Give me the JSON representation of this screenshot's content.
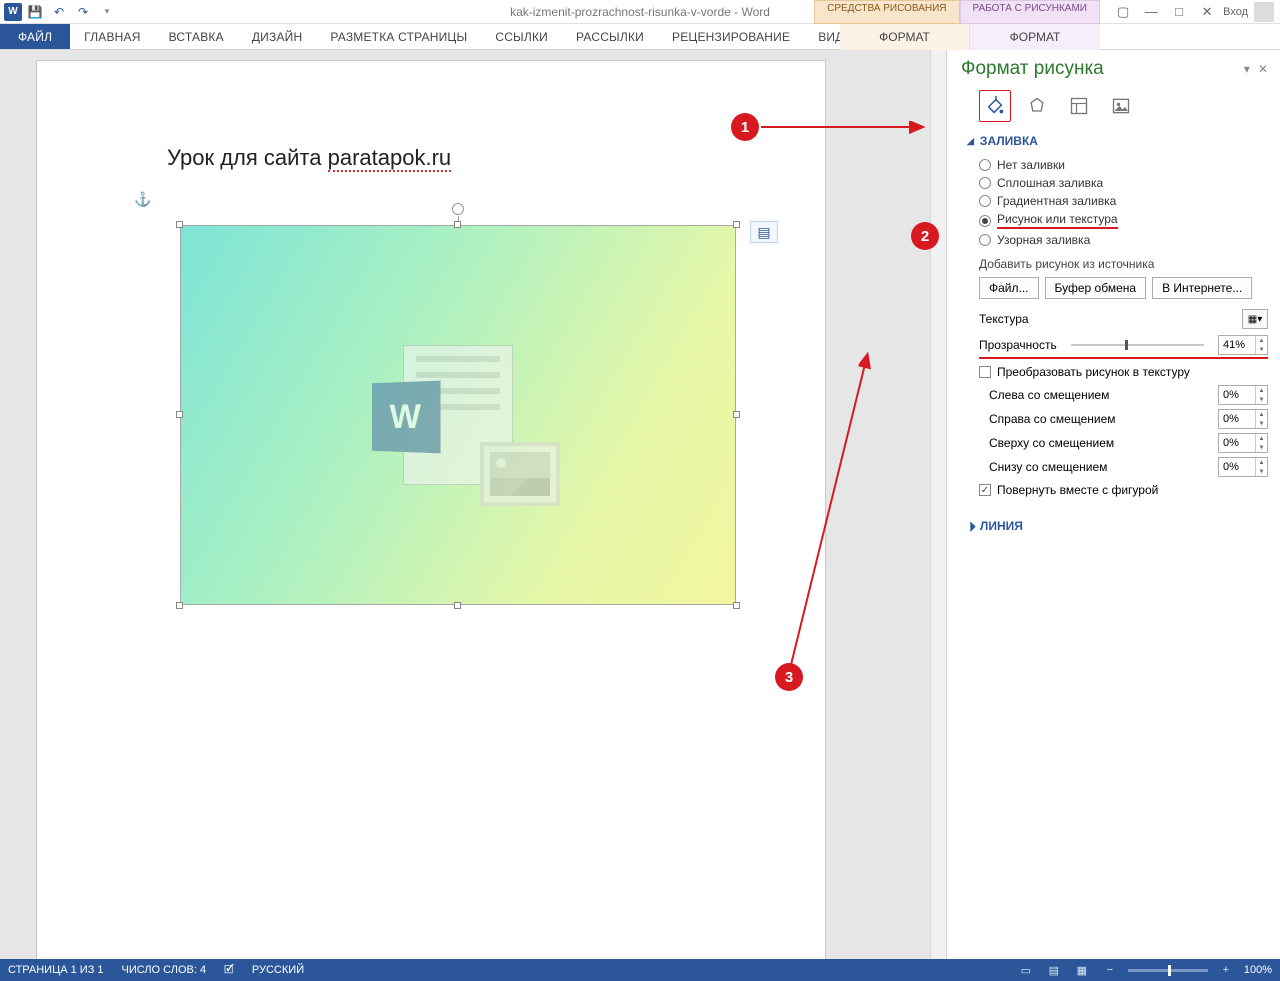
{
  "titlebar": {
    "title": "kak-izmenit-prozrachnost-risunka-v-vorde - Word",
    "login": "Вход"
  },
  "context_tabs": {
    "drawing_tools": "СРЕДСТВА РИСОВАНИЯ",
    "picture_tools": "РАБОТА С РИСУНКАМИ",
    "format_draw": "ФОРМАТ",
    "format_pic": "ФОРМАТ"
  },
  "ribbon": {
    "file": "ФАЙЛ",
    "home": "ГЛАВНАЯ",
    "insert": "ВСТАВКА",
    "design": "ДИЗАЙН",
    "layout": "РАЗМЕТКА СТРАНИЦЫ",
    "references": "ССЫЛКИ",
    "mailings": "РАССЫЛКИ",
    "review": "РЕЦЕНЗИРОВАНИЕ",
    "view": "ВИД"
  },
  "document": {
    "heading_pre": "Урок для сайта ",
    "heading_link": "paratapok.ru"
  },
  "taskpane": {
    "title": "Формат рисунка",
    "section_fill": "ЗАЛИВКА",
    "fill_options": {
      "none": "Нет заливки",
      "solid": "Сплошная заливка",
      "gradient": "Градиентная заливка",
      "picture": "Рисунок или текстура",
      "pattern": "Узорная заливка"
    },
    "add_picture_label": "Добавить рисунок из источника",
    "btn_file": "Файл...",
    "btn_clipboard": "Буфер обмена",
    "btn_online": "В Интернете...",
    "texture_label": "Текстура",
    "transparency_label": "Прозрачность",
    "transparency_value": "41%",
    "tile_checkbox": "Преобразовать рисунок в текстуру",
    "offset_left": "Слева со смещением",
    "offset_right": "Справа со смещением",
    "offset_top": "Сверху со смещением",
    "offset_bottom": "Снизу со смещением",
    "offset_value": "0%",
    "rotate_checkbox": "Повернуть вместе с фигурой",
    "section_line": "ЛИНИЯ"
  },
  "annotations": {
    "n1": "1",
    "n2": "2",
    "n3": "3"
  },
  "statusbar": {
    "page": "СТРАНИЦА 1 ИЗ 1",
    "words": "ЧИСЛО СЛОВ: 4",
    "lang": "РУССКИЙ",
    "zoom": "100%"
  }
}
